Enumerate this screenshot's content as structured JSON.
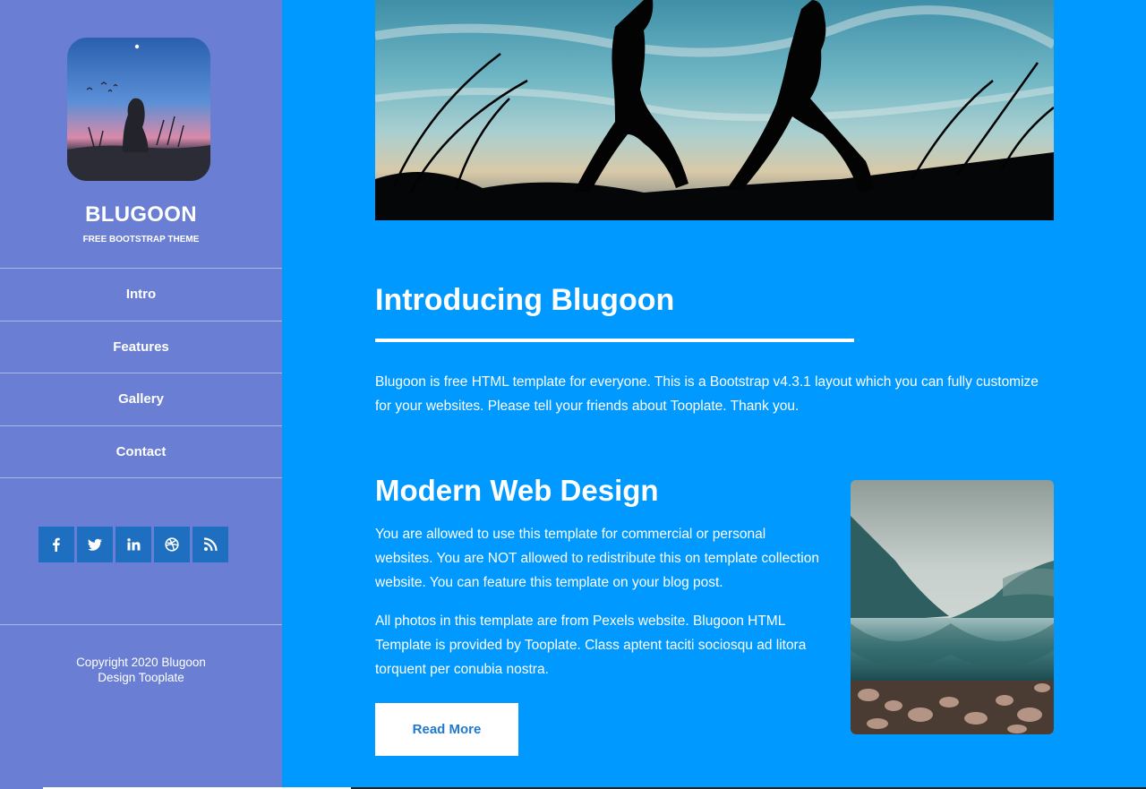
{
  "sidebar": {
    "brand": "BLUGOON",
    "tagline": "FREE BOOTSTRAP THEME",
    "nav": [
      {
        "label": "Intro"
      },
      {
        "label": "Features"
      },
      {
        "label": "Gallery"
      },
      {
        "label": "Contact"
      }
    ],
    "social": [
      {
        "icon": "facebook-icon"
      },
      {
        "icon": "twitter-icon"
      },
      {
        "icon": "linkedin-icon"
      },
      {
        "icon": "dribbble-icon"
      },
      {
        "icon": "rss-icon"
      }
    ],
    "copyright_line1": "Copyright 2020 Blugoon",
    "copyright_line2": "Design Tooplate"
  },
  "main": {
    "intro_title": "Introducing Blugoon",
    "intro_text": "Blugoon is free HTML template for everyone. This is a Bootstrap v4.3.1 layout which you can fully customize for your websites. Please tell your friends about Tooplate. Thank you.",
    "section_title": "Modern Web Design",
    "section_p1": "You are allowed to use this template for commercial or personal websites. You are NOT allowed to redistribute this on template collection website. You can feature this template on your blog post.",
    "section_p2": "All photos in this template are from Pexels website. Blugoon HTML Template is provided by Tooplate. Class aptent taciti sociosqu ad litora torquent per conubia nostra.",
    "read_more_label": "Read More"
  },
  "colors": {
    "sidebar_bg": "#6a7fd4",
    "main_bg": "#0099ff",
    "social_btn": "#1f6fc0",
    "button_text": "#1f78d1"
  }
}
